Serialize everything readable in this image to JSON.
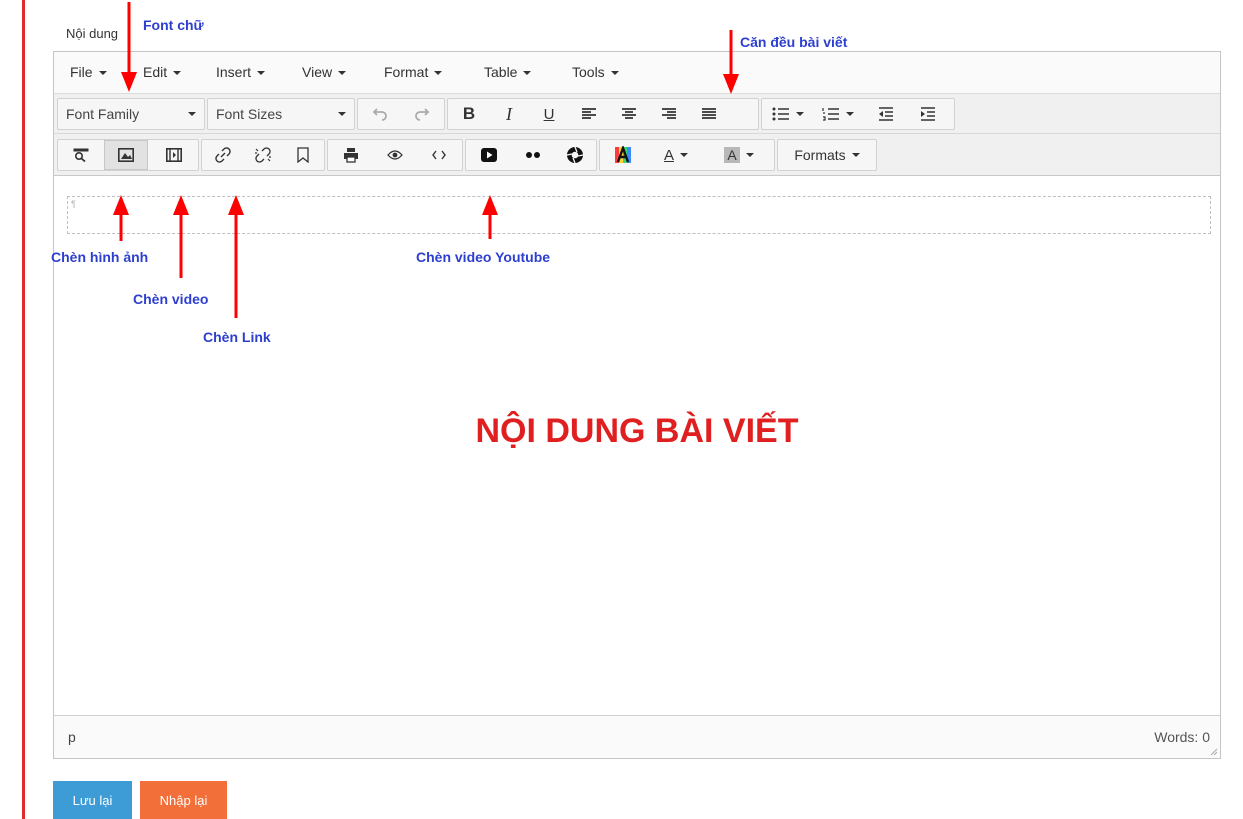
{
  "form": {
    "content_label": "Nội dung"
  },
  "menubar": {
    "items": [
      {
        "label": "File"
      },
      {
        "label": "Edit"
      },
      {
        "label": "Insert"
      },
      {
        "label": "View"
      },
      {
        "label": "Format"
      },
      {
        "label": "Table"
      },
      {
        "label": "Tools"
      }
    ]
  },
  "toolbar": {
    "font_family": "Font Family",
    "font_sizes": "Font Sizes",
    "bold": "B",
    "italic": "I",
    "underline": "U",
    "formats": "Formats",
    "text_color_letter": "A",
    "bg_color_letter": "A"
  },
  "content": {
    "body_text": "NỘI DUNG BÀI VIẾT"
  },
  "statusbar": {
    "path": "p",
    "word_count": "Words: 0"
  },
  "actions": {
    "save": "Lưu lại",
    "reset": "Nhập lại"
  },
  "annotations": {
    "font": "Font chữ",
    "justify": "Căn đều bài viết",
    "image": "Chèn hình ảnh",
    "video": "Chèn video",
    "link": "Chèn Link",
    "youtube": "Chèn video Youtube"
  },
  "colors": {
    "annotation_arrow": "#ff0000",
    "annotation_text": "#2d3fcf",
    "body_text": "#e02020"
  }
}
